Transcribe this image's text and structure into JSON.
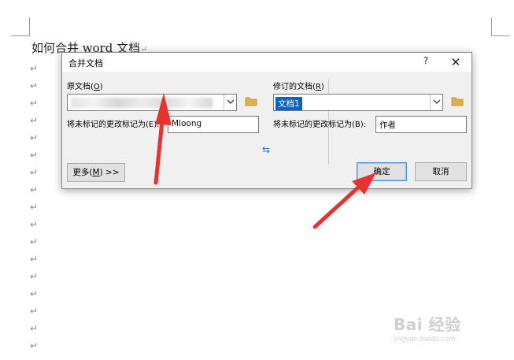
{
  "document": {
    "title": "如何合并 word 文档",
    "paragraph_mark": "↵"
  },
  "dialog": {
    "title": "合并文档",
    "help_glyph": "?",
    "close_glyph": "✕",
    "original": {
      "label_prefix": "原文档(",
      "label_key": "O",
      "label_suffix": ")",
      "unmarked_label": "将未标记的更改标记为(E):",
      "unmarked_value": "Mloong"
    },
    "revised": {
      "label_prefix": "修订的文档(",
      "label_key": "R",
      "label_suffix": ")",
      "selected_value": "文档1",
      "unmarked_label": "将未标记的更改标记为(B):",
      "unmarked_value": "作者"
    },
    "swap_glyph": "⇆",
    "buttons": {
      "more_prefix": "更多(",
      "more_key": "M",
      "more_suffix": ") >>",
      "ok": "确定",
      "cancel": "取消"
    }
  },
  "watermark": {
    "logo": "Bai 经验",
    "url": "jingyan.baidu.com"
  },
  "colors": {
    "selection": "#0a64c8",
    "annotation_arrow": "#e8322f",
    "folder": "#e0b04a"
  }
}
